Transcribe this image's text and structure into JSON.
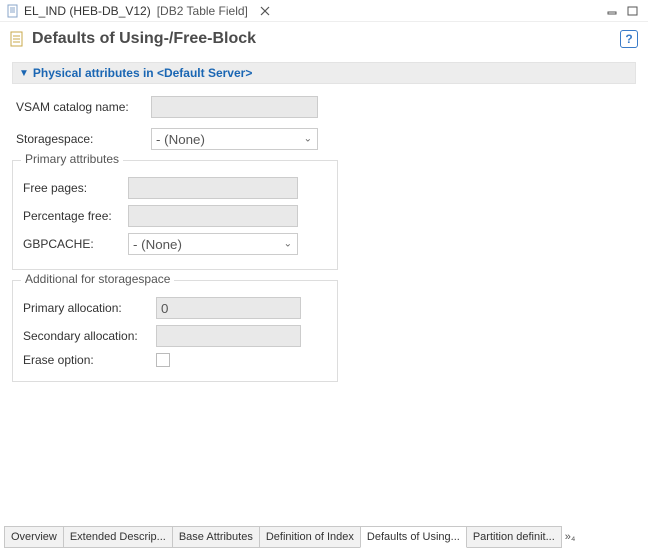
{
  "titleBar": {
    "docName": "EL_IND (HEB-DB_V12)",
    "docType": "[DB2 Table Field]"
  },
  "page": {
    "title": "Defaults of Using-/Free-Block"
  },
  "section": {
    "title": "Physical attributes in <Default Server>"
  },
  "fields": {
    "vsamCatalogLabel": "VSAM catalog name:",
    "vsamCatalogValue": "",
    "storagespaceLabel": "Storagespace:",
    "storagespaceValue": "- (None)"
  },
  "group1": {
    "title": "Primary attributes",
    "freePagesLabel": "Free pages:",
    "freePagesValue": "",
    "pctFreeLabel": "Percentage free:",
    "pctFreeValue": "",
    "gbpcacheLabel": "GBPCACHE:",
    "gbpcacheValue": "- (None)"
  },
  "group2": {
    "title": "Additional for storagespace",
    "primaryAllocLabel": "Primary allocation:",
    "primaryAllocValue": "0",
    "secondaryAllocLabel": "Secondary allocation:",
    "secondaryAllocValue": "",
    "eraseLabel": "Erase option:"
  },
  "tabs": {
    "t0": "Overview",
    "t1": "Extended Descrip...",
    "t2": "Base Attributes",
    "t3": "Definition of Index",
    "t4": "Defaults of Using...",
    "t5": "Partition definit...",
    "overflow": "»₄"
  }
}
